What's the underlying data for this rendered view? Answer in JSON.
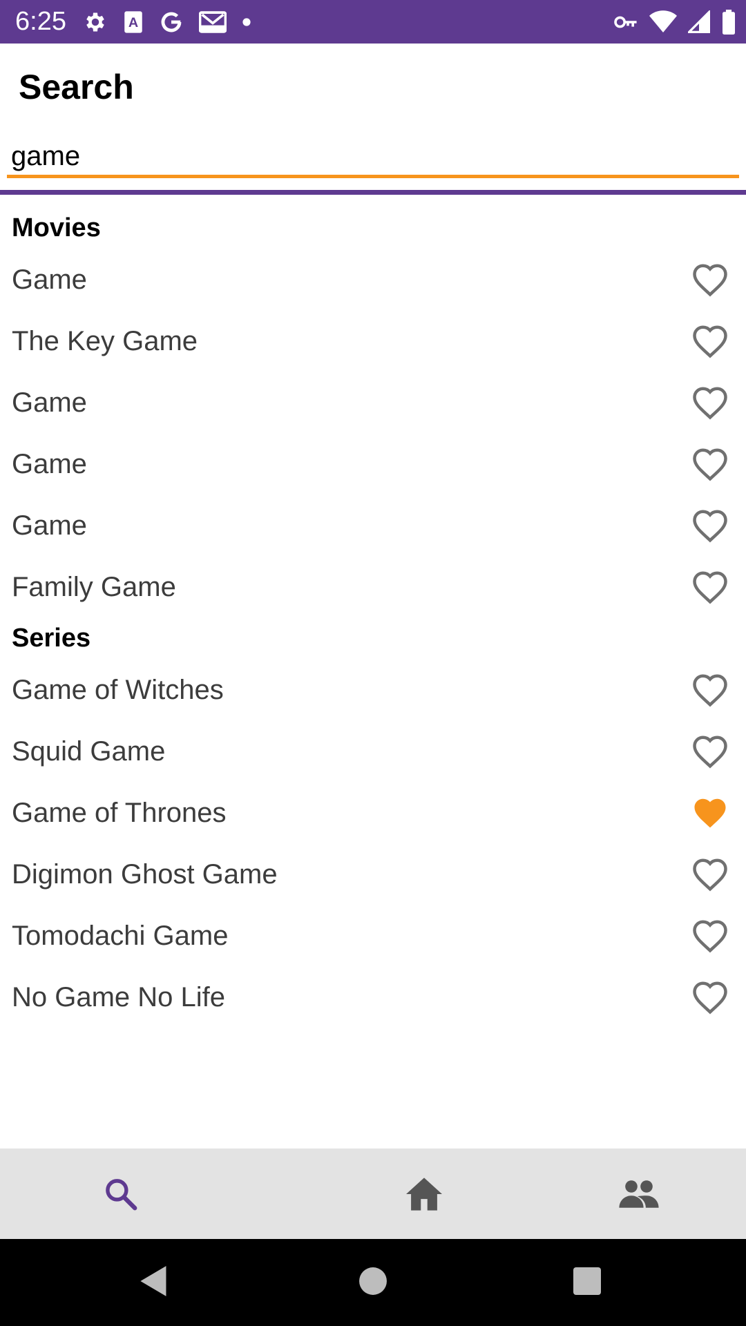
{
  "status_bar": {
    "time": "6:25",
    "background": "#5e3a90",
    "left_icons": [
      "settings-icon",
      "keyboard-a-icon",
      "google-icon",
      "gmail-icon",
      "notification-dot-icon"
    ],
    "right_icons": [
      "vpn-key-icon",
      "wifi-icon",
      "cellular-signal-icon",
      "battery-icon"
    ]
  },
  "page": {
    "title": "Search"
  },
  "search": {
    "value": "game",
    "underline_color": "#f7941d"
  },
  "sections": {
    "movies": {
      "header": "Movies",
      "items": [
        {
          "title": "Game",
          "favorite": false
        },
        {
          "title": "The Key Game",
          "favorite": false
        },
        {
          "title": "Game",
          "favorite": false
        },
        {
          "title": "Game",
          "favorite": false
        },
        {
          "title": "Game",
          "favorite": false
        },
        {
          "title": "Family Game",
          "favorite": false
        }
      ]
    },
    "series": {
      "header": "Series",
      "items": [
        {
          "title": "Game of Witches",
          "favorite": false
        },
        {
          "title": "Squid Game",
          "favorite": false
        },
        {
          "title": "Game of Thrones",
          "favorite": true
        },
        {
          "title": "Digimon Ghost Game",
          "favorite": false
        },
        {
          "title": "Tomodachi Game",
          "favorite": false
        },
        {
          "title": "No Game No Life",
          "favorite": false
        }
      ]
    }
  },
  "colors": {
    "accent_purple": "#5e3a90",
    "favorite_orange": "#f7941d",
    "heart_outline": "#707070",
    "nav_icon_inactive": "#555555"
  },
  "bottom_nav": {
    "items": [
      {
        "icon": "search-icon",
        "active": true
      },
      {
        "icon": "home-icon",
        "active": false
      },
      {
        "icon": "people-icon",
        "active": false
      }
    ]
  },
  "system_nav": {
    "icons": [
      "back-icon",
      "home-circle-icon",
      "recents-icon"
    ]
  }
}
